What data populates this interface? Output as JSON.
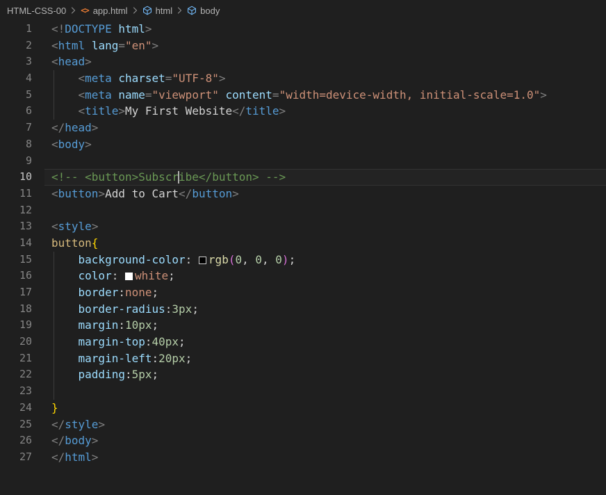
{
  "breadcrumb": {
    "items": [
      {
        "label": "HTML-CSS-00",
        "icon": ""
      },
      {
        "label": "app.html",
        "icon": "html-file-icon"
      },
      {
        "label": "html",
        "icon": "symbol-cube-icon"
      },
      {
        "label": "body",
        "icon": "symbol-cube-icon"
      }
    ]
  },
  "editor": {
    "language": "html",
    "active_line": 10,
    "cursor": {
      "line": 10,
      "after_text": "<!-- <button>Subscr"
    },
    "lines": [
      {
        "num": 1,
        "segments": [
          [
            "p",
            "<!"
          ],
          [
            "tag",
            "DOCTYPE"
          ],
          [
            "pl",
            " "
          ],
          [
            "attr",
            "html"
          ],
          [
            "p",
            ">"
          ]
        ]
      },
      {
        "num": 2,
        "segments": [
          [
            "p",
            "<"
          ],
          [
            "tag",
            "html"
          ],
          [
            "pl",
            " "
          ],
          [
            "attr",
            "lang"
          ],
          [
            "p",
            "="
          ],
          [
            "str",
            "\"en\""
          ],
          [
            "p",
            ">"
          ]
        ]
      },
      {
        "num": 3,
        "segments": [
          [
            "p",
            "<"
          ],
          [
            "tag",
            "head"
          ],
          [
            "p",
            ">"
          ]
        ]
      },
      {
        "num": 4,
        "guide": true,
        "segments": [
          [
            "pl",
            "    "
          ],
          [
            "p",
            "<"
          ],
          [
            "tag",
            "meta"
          ],
          [
            "pl",
            " "
          ],
          [
            "attr",
            "charset"
          ],
          [
            "p",
            "="
          ],
          [
            "str",
            "\"UTF-8\""
          ],
          [
            "p",
            ">"
          ]
        ]
      },
      {
        "num": 5,
        "guide": true,
        "segments": [
          [
            "pl",
            "    "
          ],
          [
            "p",
            "<"
          ],
          [
            "tag",
            "meta"
          ],
          [
            "pl",
            " "
          ],
          [
            "attr",
            "name"
          ],
          [
            "p",
            "="
          ],
          [
            "str",
            "\"viewport\""
          ],
          [
            "pl",
            " "
          ],
          [
            "attr",
            "content"
          ],
          [
            "p",
            "="
          ],
          [
            "str",
            "\"width=device-width, initial-scale=1.0\""
          ],
          [
            "p",
            ">"
          ]
        ]
      },
      {
        "num": 6,
        "guide": true,
        "segments": [
          [
            "pl",
            "    "
          ],
          [
            "p",
            "<"
          ],
          [
            "tag",
            "title"
          ],
          [
            "p",
            ">"
          ],
          [
            "txt",
            "My First Website"
          ],
          [
            "p",
            "</"
          ],
          [
            "tag",
            "title"
          ],
          [
            "p",
            ">"
          ]
        ]
      },
      {
        "num": 7,
        "segments": [
          [
            "p",
            "</"
          ],
          [
            "tag",
            "head"
          ],
          [
            "p",
            ">"
          ]
        ]
      },
      {
        "num": 8,
        "segments": [
          [
            "p",
            "<"
          ],
          [
            "tag",
            "body"
          ],
          [
            "p",
            ">"
          ]
        ]
      },
      {
        "num": 9,
        "segments": []
      },
      {
        "num": 10,
        "active": true,
        "segments": [
          [
            "cmt",
            "<!-- <button>Subscr"
          ],
          [
            "cursor",
            ""
          ],
          [
            "cmt",
            "ibe</button> -->"
          ]
        ]
      },
      {
        "num": 11,
        "segments": [
          [
            "p",
            "<"
          ],
          [
            "tag",
            "button"
          ],
          [
            "p",
            ">"
          ],
          [
            "txt",
            "Add to Cart"
          ],
          [
            "p",
            "</"
          ],
          [
            "tag",
            "button"
          ],
          [
            "p",
            ">"
          ]
        ]
      },
      {
        "num": 12,
        "segments": []
      },
      {
        "num": 13,
        "segments": [
          [
            "p",
            "<"
          ],
          [
            "tag",
            "style"
          ],
          [
            "p",
            ">"
          ]
        ]
      },
      {
        "num": 14,
        "segments": [
          [
            "sel",
            "button"
          ],
          [
            "brace",
            "{"
          ]
        ]
      },
      {
        "num": 15,
        "guide": true,
        "segments": [
          [
            "prop",
            "    background-color"
          ],
          [
            "pl",
            ": "
          ],
          [
            "swatch-black",
            ""
          ],
          [
            "fn",
            "rgb"
          ],
          [
            "paren",
            "("
          ],
          [
            "num",
            "0"
          ],
          [
            "pl",
            ", "
          ],
          [
            "num",
            "0"
          ],
          [
            "pl",
            ", "
          ],
          [
            "num",
            "0"
          ],
          [
            "paren",
            ")"
          ],
          [
            "pl",
            ";"
          ]
        ]
      },
      {
        "num": 16,
        "guide": true,
        "segments": [
          [
            "prop",
            "    color"
          ],
          [
            "pl",
            ": "
          ],
          [
            "swatch-white",
            ""
          ],
          [
            "val",
            "white"
          ],
          [
            "pl",
            ";"
          ]
        ]
      },
      {
        "num": 17,
        "guide": true,
        "segments": [
          [
            "prop",
            "    border"
          ],
          [
            "pl",
            ":"
          ],
          [
            "val",
            "none"
          ],
          [
            "pl",
            ";"
          ]
        ]
      },
      {
        "num": 18,
        "guide": true,
        "segments": [
          [
            "prop",
            "    border-radius"
          ],
          [
            "pl",
            ":"
          ],
          [
            "num",
            "3px"
          ],
          [
            "pl",
            ";"
          ]
        ]
      },
      {
        "num": 19,
        "guide": true,
        "segments": [
          [
            "prop",
            "    margin"
          ],
          [
            "pl",
            ":"
          ],
          [
            "num",
            "10px"
          ],
          [
            "pl",
            ";"
          ]
        ]
      },
      {
        "num": 20,
        "guide": true,
        "segments": [
          [
            "prop",
            "    margin-top"
          ],
          [
            "pl",
            ":"
          ],
          [
            "num",
            "40px"
          ],
          [
            "pl",
            ";"
          ]
        ]
      },
      {
        "num": 21,
        "guide": true,
        "segments": [
          [
            "prop",
            "    margin-left"
          ],
          [
            "pl",
            ":"
          ],
          [
            "num",
            "20px"
          ],
          [
            "pl",
            ";"
          ]
        ]
      },
      {
        "num": 22,
        "guide": true,
        "segments": [
          [
            "prop",
            "    padding"
          ],
          [
            "pl",
            ":"
          ],
          [
            "num",
            "5px"
          ],
          [
            "pl",
            ";"
          ]
        ]
      },
      {
        "num": 23,
        "guide": true,
        "segments": []
      },
      {
        "num": 24,
        "segments": [
          [
            "brace",
            "}"
          ]
        ]
      },
      {
        "num": 25,
        "segments": [
          [
            "p",
            "</"
          ],
          [
            "tag",
            "style"
          ],
          [
            "p",
            ">"
          ]
        ]
      },
      {
        "num": 26,
        "segments": [
          [
            "p",
            "</"
          ],
          [
            "tag",
            "body"
          ],
          [
            "p",
            ">"
          ]
        ]
      },
      {
        "num": 27,
        "segments": [
          [
            "p",
            "</"
          ],
          [
            "tag",
            "html"
          ],
          [
            "p",
            ">"
          ]
        ]
      }
    ]
  },
  "colors": {
    "background": "#1f1f1f",
    "tag": "#569cd6",
    "attribute": "#9cdcfe",
    "string": "#ce9178",
    "comment": "#6a9955",
    "css_selector": "#d7ba7d",
    "css_property": "#9cdcfe",
    "css_value": "#ce9178",
    "number": "#b5cea8",
    "function": "#dcdcaa",
    "brace": "#ffd700",
    "paren": "#d670d6",
    "html_punctuation": "#808080",
    "plain_text": "#d4d4d4",
    "line_number": "#858585",
    "active_line_number": "#c6c6c6",
    "breadcrumb_text": "#b4b4b4",
    "html_file_icon": "#e37933",
    "symbol_icon": "#75beff",
    "cursor": "#aeafad"
  }
}
